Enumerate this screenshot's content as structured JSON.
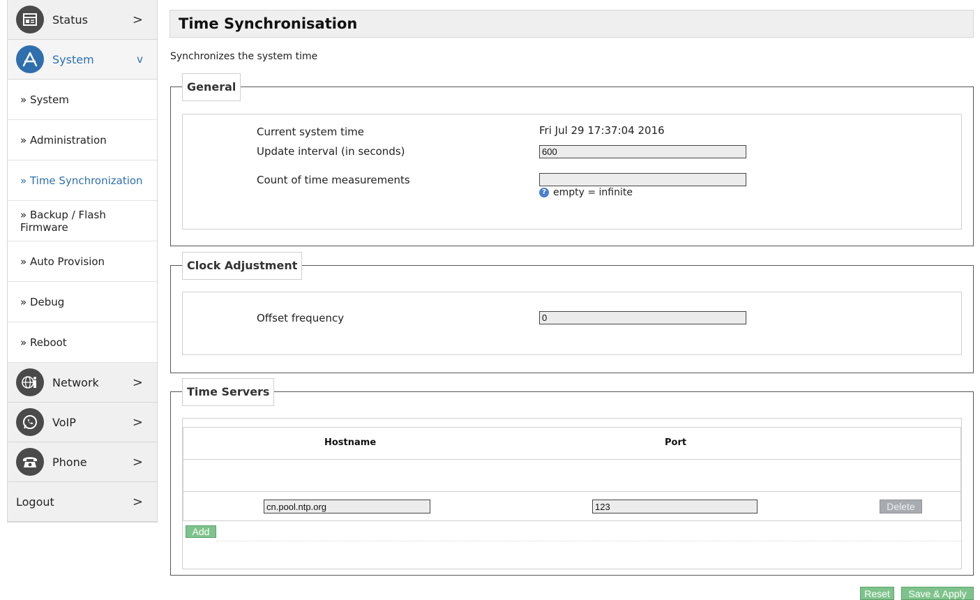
{
  "sidebar": {
    "categories": {
      "status": {
        "label": "Status",
        "icon": "status-icon"
      },
      "system": {
        "label": "System",
        "icon": "system-icon"
      },
      "network": {
        "label": "Network",
        "icon": "network-icon"
      },
      "voip": {
        "label": "VoIP",
        "icon": "voip-icon"
      },
      "phone": {
        "label": "Phone",
        "icon": "phone-icon"
      },
      "logout": {
        "label": "Logout"
      }
    },
    "system_items": [
      {
        "label": "» System"
      },
      {
        "label": "» Administration"
      },
      {
        "label": "» Time Synchronization"
      },
      {
        "label": "» Backup / Flash Firmware"
      },
      {
        "label": "» Auto Provision"
      },
      {
        "label": "» Debug"
      },
      {
        "label": "» Reboot"
      }
    ],
    "active_item": "» Time Synchronization",
    "chevron_right": ">",
    "chevron_down": "v"
  },
  "page": {
    "title": "Time Synchronisation",
    "description": "Synchronizes the system time"
  },
  "general": {
    "legend": "General",
    "current_time_label": "Current system time",
    "current_time_value": "Fri Jul 29 17:37:04 2016",
    "update_interval_label": "Update interval (in seconds)",
    "update_interval_value": "600",
    "count_label": "Count of time measurements",
    "count_value": "",
    "count_hint": "empty = infinite"
  },
  "clock": {
    "legend": "Clock Adjustment",
    "offset_label": "Offset frequency",
    "offset_value": "0"
  },
  "servers": {
    "legend": "Time Servers",
    "col_hostname": "Hostname",
    "col_port": "Port",
    "rows": [
      {
        "hostname": "cn.pool.ntp.org",
        "port": "123",
        "delete_label": "Delete"
      }
    ],
    "add_label": "Add"
  },
  "footer": {
    "reset_label": "Reset",
    "save_label": "Save & Apply"
  },
  "colors": {
    "accent": "#2f6fae",
    "button_green": "#7fc38c",
    "button_disabled": "#a8acb0"
  }
}
